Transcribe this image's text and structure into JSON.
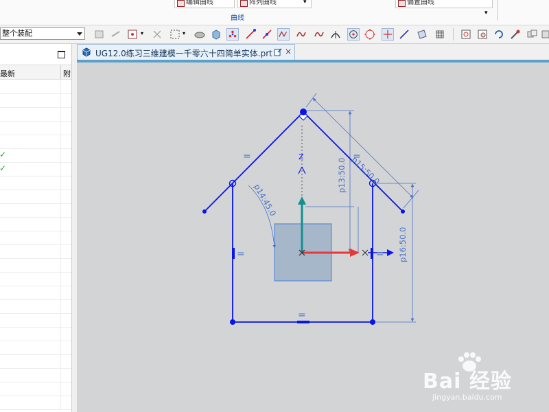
{
  "ribbon": {
    "button_1": "编辑曲线",
    "button_2": "阵列曲线",
    "button_3": "偏置曲线",
    "group_label": "曲线"
  },
  "toolbar": {
    "assembly_select": "整个装配"
  },
  "navigator": {
    "col_latest": "最新",
    "col_partial": "附",
    "row_count": 24,
    "checked_rows": [
      5,
      6
    ]
  },
  "graphics": {
    "tab_title": "UG12.0练习三维建模一千零六十四简单实体.prt",
    "tab_close": "×",
    "axis_label": "Z"
  },
  "sketch": {
    "dim_p15": "p15:50.0",
    "dim_p14": "p14:45.0",
    "dim_p13": "p13:50.0",
    "dim_p16": "p16:50.0",
    "constraint_equal": "="
  },
  "colors": {
    "sketch_blue": "#0a14e6",
    "dimension_blue": "#4a72c4",
    "face_fill": "#a6b7c9",
    "axis_red": "#e23a3a",
    "axis_teal": "#129090",
    "viewport_bg": "#d3d4d6"
  },
  "watermark": {
    "brand": "Bai 经验",
    "sub": "jingyan.baidu.com"
  }
}
